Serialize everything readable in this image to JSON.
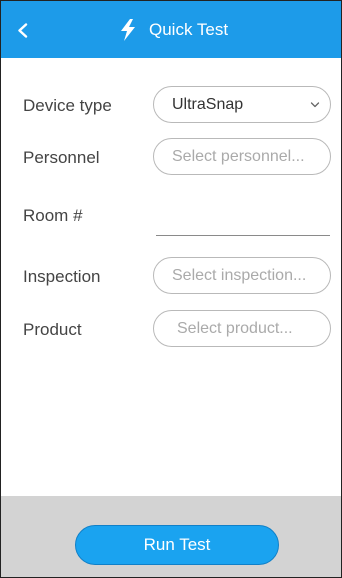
{
  "header": {
    "back_icon": "chevron-left-icon",
    "bolt_icon": "lightning-bolt-icon",
    "title": "Quick Test"
  },
  "form": {
    "device_type": {
      "label": "Device type",
      "value": "UltraSnap",
      "icon": "chevron-down-icon"
    },
    "personnel": {
      "label": "Personnel",
      "placeholder": "Select personnel..."
    },
    "room": {
      "label": "Room #",
      "value": ""
    },
    "inspection": {
      "label": "Inspection",
      "placeholder": "Select inspection..."
    },
    "product": {
      "label": "Product",
      "placeholder": "Select product..."
    }
  },
  "footer": {
    "run_label": "Run Test"
  },
  "colors": {
    "header": "#1d9be9",
    "button": "#1aa3f0",
    "footer": "#d3d3d3"
  }
}
